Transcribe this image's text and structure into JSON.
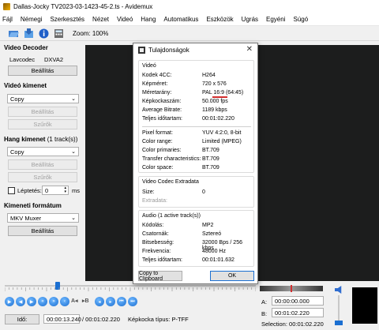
{
  "window": {
    "title": "Dallas-Jocky TV2023-03-1423-45-2.ts - Avidemux"
  },
  "menu": [
    "Fájl",
    "Némegi",
    "Szerkesztés",
    "Nézet",
    "Videó",
    "Hang",
    "Automatikus",
    "Eszközök",
    "Ugrás",
    "Egyéni",
    "Súgó"
  ],
  "toolbar": {
    "zoom": "Zoom: 100%"
  },
  "video_decoder": {
    "title": "Video Decoder",
    "codec_label": "Lavcodec",
    "codec_value": "DXVA2",
    "settings": "Beállítás"
  },
  "video_output": {
    "title": "Videó kimenet",
    "selected": "Copy",
    "settings": "Beállítás",
    "filters": "Szűrők"
  },
  "audio_output": {
    "title": "Hang kimenet",
    "tracks": "(1 track(s))",
    "selected": "Copy",
    "settings": "Beállítás",
    "filters": "Szűrők",
    "shift_label": "Léptetés:",
    "shift_value": "0",
    "shift_unit": "ms"
  },
  "output_format": {
    "title": "Kimeneti formátum",
    "selected": "MKV Muxer",
    "settings": "Beállítás"
  },
  "dialog": {
    "title": "Tulajdonságok",
    "video": {
      "title": "Videó",
      "rows": [
        {
          "k": "Kodek 4CC:",
          "v": "H264"
        },
        {
          "k": "Képméret:",
          "v": "720 x 576"
        },
        {
          "k": "Méretarány:",
          "v": "PAL 16:9 (64:45)"
        },
        {
          "k": "Képkockaszám:",
          "v": "50.000 fps"
        },
        {
          "k": "Average Bitrate:",
          "v": "1189 kbps"
        },
        {
          "k": "Teljes időtartam:",
          "v": "00:01:02.220"
        }
      ],
      "rows2": [
        {
          "k": "Pixel format:",
          "v": "YUV 4:2:0, 8-bit"
        },
        {
          "k": "Color range:",
          "v": "Limited (MPEG)"
        },
        {
          "k": "Color primaries:",
          "v": "BT.709"
        },
        {
          "k": "Transfer characteristics:",
          "v": "BT.709"
        },
        {
          "k": "Color space:",
          "v": "BT.709"
        }
      ]
    },
    "extradata": {
      "title": "Video Codec Extradata",
      "size_label": "Size:",
      "size_value": "0",
      "data_label": "Extradata:"
    },
    "audio": {
      "title": "Audio (1 active track(s))",
      "rows": [
        {
          "k": "Kódolás:",
          "v": "MP2"
        },
        {
          "k": "Csatornák:",
          "v": "Sztereó"
        },
        {
          "k": "Bitsebesség:",
          "v": "32000 Bps / 256 kbps"
        },
        {
          "k": "Frekvencia:",
          "v": "48000 Hz"
        },
        {
          "k": "Teljes időtartam:",
          "v": "00:01:01.632"
        }
      ]
    },
    "copy_button": "Copy to Clipboard",
    "ok_button": "OK"
  },
  "transport": {
    "time_label": "Idő:",
    "current_time": "00:00:13.240",
    "total_time": "/ 00:01:02.220",
    "frame_type": "Képkocka típus:  P-TFF",
    "a_label": "A:",
    "a_value": "00:00:00.000",
    "b_label": "B:",
    "b_value": "00:01:02.220",
    "selection": "Selection: 00:01:02.220",
    "position_fraction": 0.21
  },
  "colors": {
    "accent": "#1b6fd1",
    "preview_bg": "#1c1d1d",
    "underline": "#d32f2f"
  }
}
